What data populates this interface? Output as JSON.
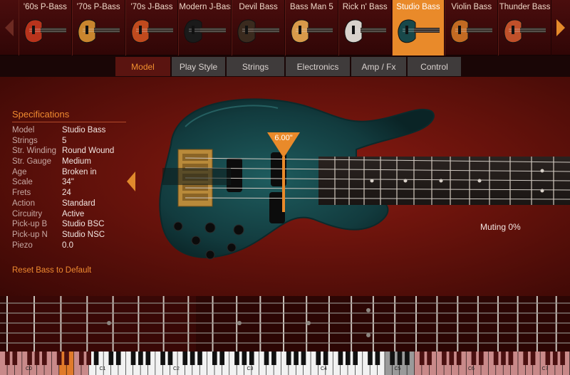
{
  "bass_selector": {
    "items": [
      {
        "name": "'60s P-Bass",
        "body_color": "#b8331c",
        "active": false
      },
      {
        "name": "'70s P-Bass",
        "body_color": "#c9852e",
        "active": false
      },
      {
        "name": "'70s J-Bass",
        "body_color": "#c04a1e",
        "active": false
      },
      {
        "name": "Modern J-Bass",
        "body_color": "#1a1a1a",
        "active": false
      },
      {
        "name": "Devil Bass",
        "body_color": "#3a2a1e",
        "active": false
      },
      {
        "name": "Bass Man 5",
        "body_color": "#d89a4a",
        "active": false
      },
      {
        "name": "Rick n' Bass",
        "body_color": "#d8d2cc",
        "active": false
      },
      {
        "name": "Studio Bass",
        "body_color": "#18484a",
        "active": true
      },
      {
        "name": "Violin Bass",
        "body_color": "#c26a22",
        "active": false
      },
      {
        "name": "Thunder Bass",
        "body_color": "#c0502a",
        "active": false
      }
    ]
  },
  "tabs": [
    {
      "label": "Model",
      "active": true
    },
    {
      "label": "Play Style",
      "active": false
    },
    {
      "label": "Strings",
      "active": false
    },
    {
      "label": "Electronics",
      "active": false
    },
    {
      "label": "Amp / Fx",
      "active": false
    },
    {
      "label": "Control",
      "active": false
    }
  ],
  "specifications": {
    "title": "Specifications",
    "rows": [
      {
        "key": "Model",
        "value": "Studio Bass"
      },
      {
        "key": "Strings",
        "value": "5"
      },
      {
        "key": "Str. Winding",
        "value": "Round Wound"
      },
      {
        "key": "Str. Gauge",
        "value": "Medium"
      },
      {
        "key": "Age",
        "value": "Broken in"
      },
      {
        "key": "Scale",
        "value": "34\""
      },
      {
        "key": "Frets",
        "value": "24"
      },
      {
        "key": "Action",
        "value": "Standard"
      },
      {
        "key": "Circuitry",
        "value": "Active"
      },
      {
        "key": "Pick-up B",
        "value": "Studio BSC"
      },
      {
        "key": "Pick-up N",
        "value": "Studio NSC"
      },
      {
        "key": "Piezo",
        "value": "0.0"
      }
    ]
  },
  "reset_label": "Reset Bass to Default",
  "pick_position_label": "6.00\"",
  "muting_label": "Muting 0%",
  "keyboard": {
    "octave_labels": [
      "C0",
      "C1",
      "C2",
      "C3",
      "C4",
      "C5",
      "C6",
      "C7"
    ]
  },
  "colors": {
    "accent": "#e98a2a",
    "background": "#6a130c",
    "bass_body": "#17464a"
  }
}
